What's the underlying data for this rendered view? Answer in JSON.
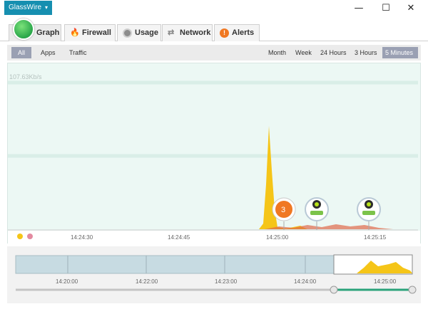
{
  "app": {
    "title": "GlassWire"
  },
  "window_controls": {
    "minimize": "—",
    "maximize": "☐",
    "close": "✕"
  },
  "tabs": [
    {
      "label": "Graph",
      "icon": "graph-icon"
    },
    {
      "label": "Firewall",
      "icon": "flame-icon"
    },
    {
      "label": "Usage",
      "icon": "usage-icon"
    },
    {
      "label": "Network",
      "icon": "network-icon"
    },
    {
      "label": "Alerts",
      "icon": "alert-icon"
    }
  ],
  "filters": [
    "All",
    "Apps",
    "Traffic"
  ],
  "ranges": [
    "Month",
    "Week",
    "24 Hours",
    "3 Hours",
    "5 Minutes"
  ],
  "graph": {
    "scale_label": "107.63Kb/s",
    "time_labels": [
      "14:24:30",
      "14:24:45",
      "14:25:00",
      "14:25:15"
    ],
    "event_count": "3",
    "markers": [
      "event-marker",
      "app-marker",
      "app-marker"
    ]
  },
  "overview": {
    "time_labels": [
      "14:20:00",
      "14:22:00",
      "14:23:00",
      "14:24:00",
      "14:25:00"
    ]
  },
  "colors": {
    "accent": "#168fb0",
    "graph_bg": "#ecf8f4",
    "traffic": "#f5c518",
    "outgoing": "#e06a4a",
    "selection": "#2aa37a"
  }
}
